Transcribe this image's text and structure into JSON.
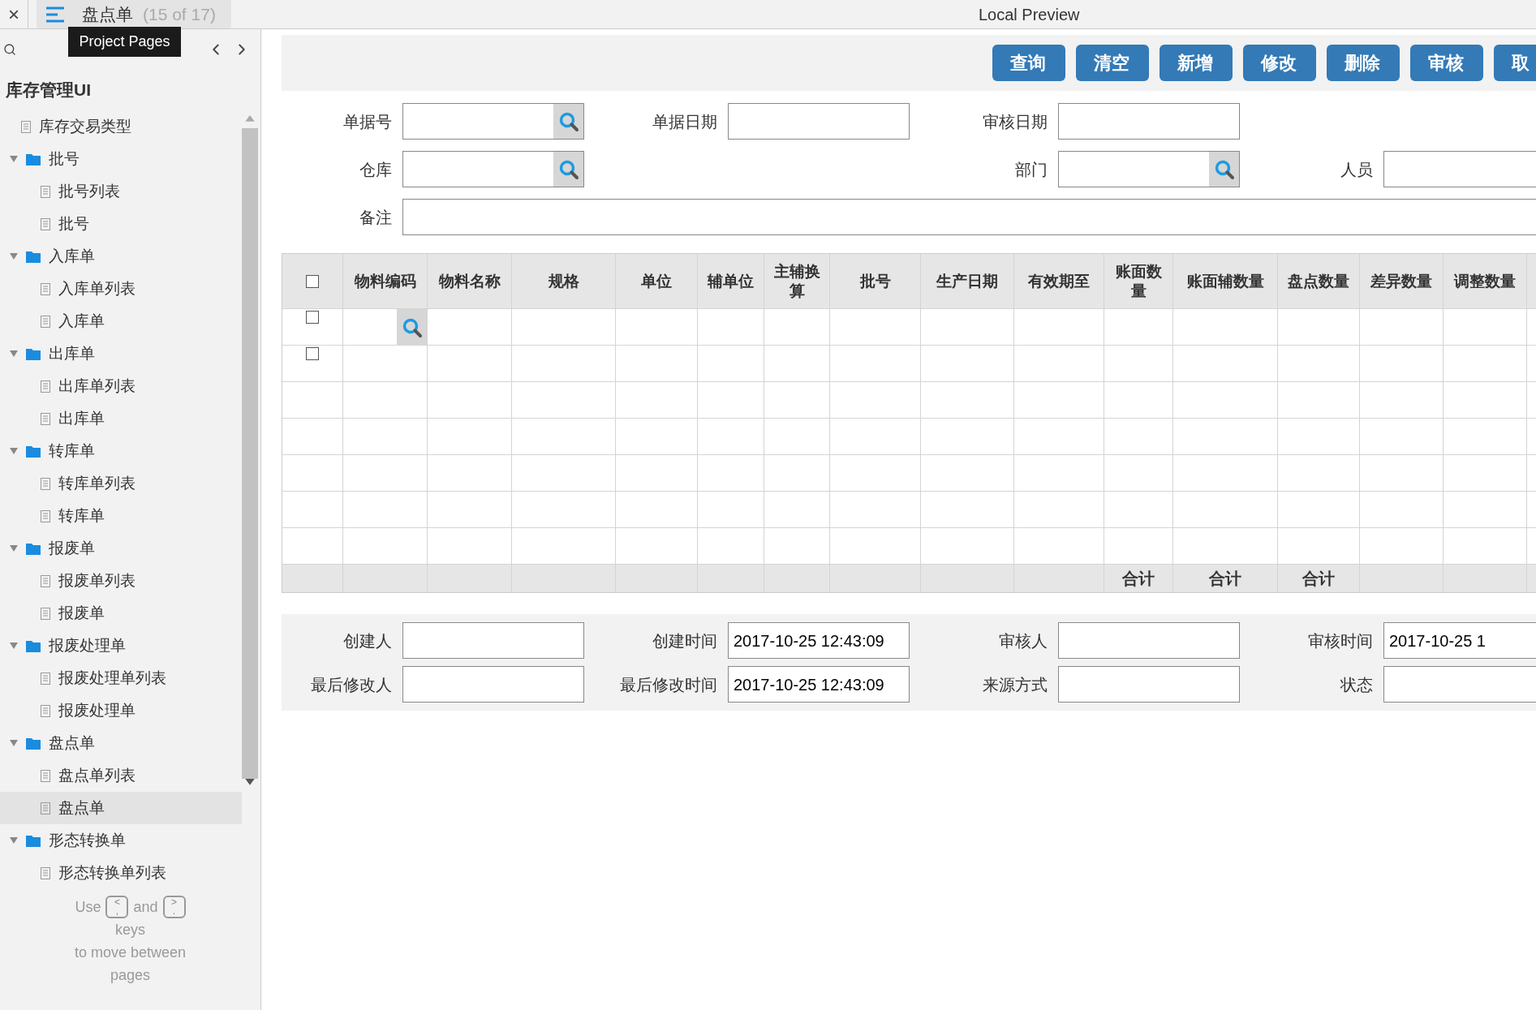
{
  "top_bar": {
    "close": "×",
    "page_title": "盘点单",
    "page_counter": "(15 of 17)",
    "tooltip": "Project Pages",
    "window_title": "Local Preview"
  },
  "sidebar": {
    "project": "库存管理UI",
    "items": [
      {
        "kind": "page",
        "label": "库存交易类型",
        "selected": false
      },
      {
        "kind": "folder",
        "label": "批号",
        "expanded": true,
        "selected": false,
        "children": [
          {
            "kind": "page",
            "label": "批号列表",
            "selected": false
          },
          {
            "kind": "page",
            "label": "批号",
            "selected": false
          }
        ]
      },
      {
        "kind": "folder",
        "label": "入库单",
        "expanded": true,
        "selected": false,
        "children": [
          {
            "kind": "page",
            "label": "入库单列表",
            "selected": false
          },
          {
            "kind": "page",
            "label": "入库单",
            "selected": false
          }
        ]
      },
      {
        "kind": "folder",
        "label": "出库单",
        "expanded": true,
        "selected": false,
        "children": [
          {
            "kind": "page",
            "label": "出库单列表",
            "selected": false
          },
          {
            "kind": "page",
            "label": "出库单",
            "selected": false
          }
        ]
      },
      {
        "kind": "folder",
        "label": "转库单",
        "expanded": true,
        "selected": false,
        "children": [
          {
            "kind": "page",
            "label": "转库单列表",
            "selected": false
          },
          {
            "kind": "page",
            "label": "转库单",
            "selected": false
          }
        ]
      },
      {
        "kind": "folder",
        "label": "报废单",
        "expanded": true,
        "selected": false,
        "children": [
          {
            "kind": "page",
            "label": "报废单列表",
            "selected": false
          },
          {
            "kind": "page",
            "label": "报废单",
            "selected": false
          }
        ]
      },
      {
        "kind": "folder",
        "label": "报废处理单",
        "expanded": true,
        "selected": false,
        "children": [
          {
            "kind": "page",
            "label": "报废处理单列表",
            "selected": false
          },
          {
            "kind": "page",
            "label": "报废处理单",
            "selected": false
          }
        ]
      },
      {
        "kind": "folder",
        "label": "盘点单",
        "expanded": true,
        "selected": false,
        "children": [
          {
            "kind": "page",
            "label": "盘点单列表",
            "selected": false
          },
          {
            "kind": "page",
            "label": "盘点单",
            "selected": true
          }
        ]
      },
      {
        "kind": "folder",
        "label": "形态转换单",
        "expanded": true,
        "selected": false,
        "children": [
          {
            "kind": "page",
            "label": "形态转换单列表",
            "selected": false
          }
        ]
      }
    ],
    "hint": {
      "before": "Use",
      "prev_key": {
        "top": "<",
        "bottom": ","
      },
      "middle": "and",
      "next_key": {
        "top": ">",
        "bottom": "."
      },
      "after_lines": [
        "keys",
        "to move between",
        "pages"
      ]
    }
  },
  "toolbar": {
    "buttons": [
      "查询",
      "清空",
      "新增",
      "修改",
      "删除",
      "审核",
      "取"
    ]
  },
  "form": {
    "rows": [
      [
        {
          "kind": "lookup",
          "label": "单据号"
        },
        {
          "kind": "text",
          "label": "单据日期"
        },
        {
          "kind": "text",
          "label": "审核日期"
        }
      ],
      [
        {
          "kind": "lookup",
          "label": "仓库"
        },
        {
          "kind": "empty"
        },
        {
          "kind": "lookup",
          "label": "部门"
        },
        {
          "kind": "text",
          "label": "人员"
        }
      ],
      [
        {
          "kind": "wide",
          "label": "备注"
        }
      ]
    ]
  },
  "table": {
    "columns": [
      {
        "kind": "checkbox",
        "checked": false
      },
      {
        "kind": "text",
        "label": "物料编码"
      },
      {
        "kind": "text",
        "label": "物料名称"
      },
      {
        "kind": "text",
        "label": "规格"
      },
      {
        "kind": "text",
        "label": "单位"
      },
      {
        "kind": "text",
        "label": "辅单位"
      },
      {
        "kind": "text",
        "label": "主辅换算"
      },
      {
        "kind": "text",
        "label": "批号"
      },
      {
        "kind": "text",
        "label": "生产日期"
      },
      {
        "kind": "text",
        "label": "有效期至"
      },
      {
        "kind": "text",
        "label": "账面数量"
      },
      {
        "kind": "text",
        "label": "账面辅数量"
      },
      {
        "kind": "text",
        "label": "盘点数量"
      },
      {
        "kind": "text",
        "label": "差异数量"
      },
      {
        "kind": "text",
        "label": "调整数量"
      },
      {
        "kind": "blank"
      }
    ],
    "rows": [
      {
        "kind": "lookup",
        "checked": false
      },
      {
        "kind": "checkbox",
        "checked": false
      },
      {
        "kind": "empty"
      },
      {
        "kind": "empty"
      },
      {
        "kind": "empty"
      },
      {
        "kind": "empty"
      },
      {
        "kind": "empty"
      }
    ],
    "footer": [
      {
        "kind": "blank"
      },
      {
        "kind": "blank"
      },
      {
        "kind": "blank"
      },
      {
        "kind": "blank"
      },
      {
        "kind": "blank"
      },
      {
        "kind": "blank"
      },
      {
        "kind": "blank"
      },
      {
        "kind": "blank"
      },
      {
        "kind": "blank"
      },
      {
        "kind": "blank"
      },
      {
        "kind": "total",
        "text": "合计"
      },
      {
        "kind": "total",
        "text": "合计"
      },
      {
        "kind": "total",
        "text": "合计"
      },
      {
        "kind": "blank"
      },
      {
        "kind": "blank"
      },
      {
        "kind": "blank"
      }
    ]
  },
  "audit_form": {
    "rows": [
      [
        {
          "kind": "text",
          "label": "创建人"
        },
        {
          "kind": "text",
          "label": "创建时间",
          "value": "2017-10-25 12:43:09"
        },
        {
          "kind": "text",
          "label": "审核人"
        },
        {
          "kind": "text",
          "label": "审核时间",
          "value": "2017-10-25 1"
        }
      ],
      [
        {
          "kind": "text",
          "label": "最后修改人"
        },
        {
          "kind": "text",
          "label": "最后修改时间",
          "value": "2017-10-25 12:43:09"
        },
        {
          "kind": "text",
          "label": "来源方式"
        },
        {
          "kind": "text",
          "label": "状态"
        }
      ]
    ]
  }
}
